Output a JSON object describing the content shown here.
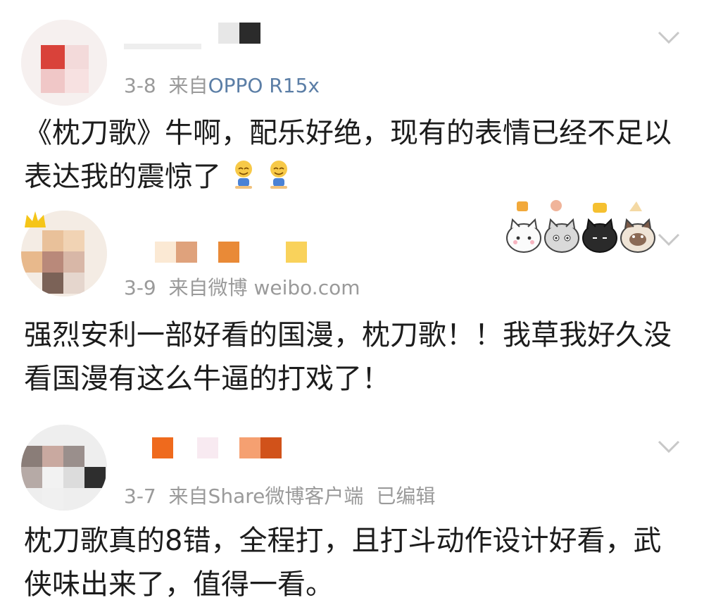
{
  "comments": [
    {
      "date": "3-8",
      "source_prefix": "来自",
      "device": "OPPO R15x",
      "edited": "",
      "text": "《枕刀歌》牛啊，配乐好绝，现有的表情已经不足以表达我的震惊了",
      "emoji_icon": "sweat-smile-emoji-icon"
    },
    {
      "date": "3-9",
      "source_prefix": "来自微博",
      "device": "weibo.com",
      "edited": "",
      "text": "强烈安利一部好看的国漫，枕刀歌！！我草我好久没看国漫有这么牛逼的打戏了！",
      "badge_icon": "cat-sticker-badge-icon"
    },
    {
      "date": "3-7",
      "source_prefix": "来自Share微博客户端",
      "device": "",
      "edited": "已编辑",
      "text": "枕刀歌真的8错，全程打，且打斗动作设计好看，武侠味出来了，值得一看。"
    }
  ],
  "colors": {
    "meta_gray": "#9a9a9a",
    "device_blue": "#5b7ea6",
    "text": "#1c1c1c",
    "chevron": "#c8c8c8"
  },
  "icons": {
    "menu": "chevron-down-icon"
  }
}
